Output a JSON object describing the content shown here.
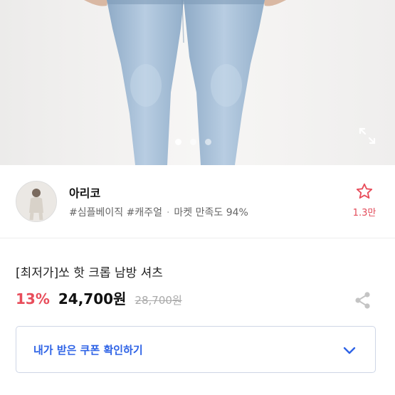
{
  "product_image": {
    "carousel": {
      "count": 3,
      "active_index": 0
    },
    "icons": {
      "expand": "expand-icon"
    }
  },
  "store": {
    "name": "아리코",
    "tags": "#심플베이직 #캐주얼",
    "separator": "·",
    "satisfaction": "마켓 만족도 94%",
    "favorite_count": "1.3만",
    "icons": {
      "favorite": "star-outline-icon"
    }
  },
  "product": {
    "title": "[최저가]쏘 핫 크롭 남방 셔츠",
    "discount": "13%",
    "price": "24,700원",
    "original_price": "28,700원",
    "icons": {
      "share": "share-icon"
    }
  },
  "coupon": {
    "label": "내가 받은 쿠폰 확인하기",
    "icons": {
      "toggle": "chevron-down-icon"
    }
  },
  "colors": {
    "accent_red": "#e84d5b",
    "accent_blue": "#2e63e6",
    "denim": "#a9c2db"
  }
}
